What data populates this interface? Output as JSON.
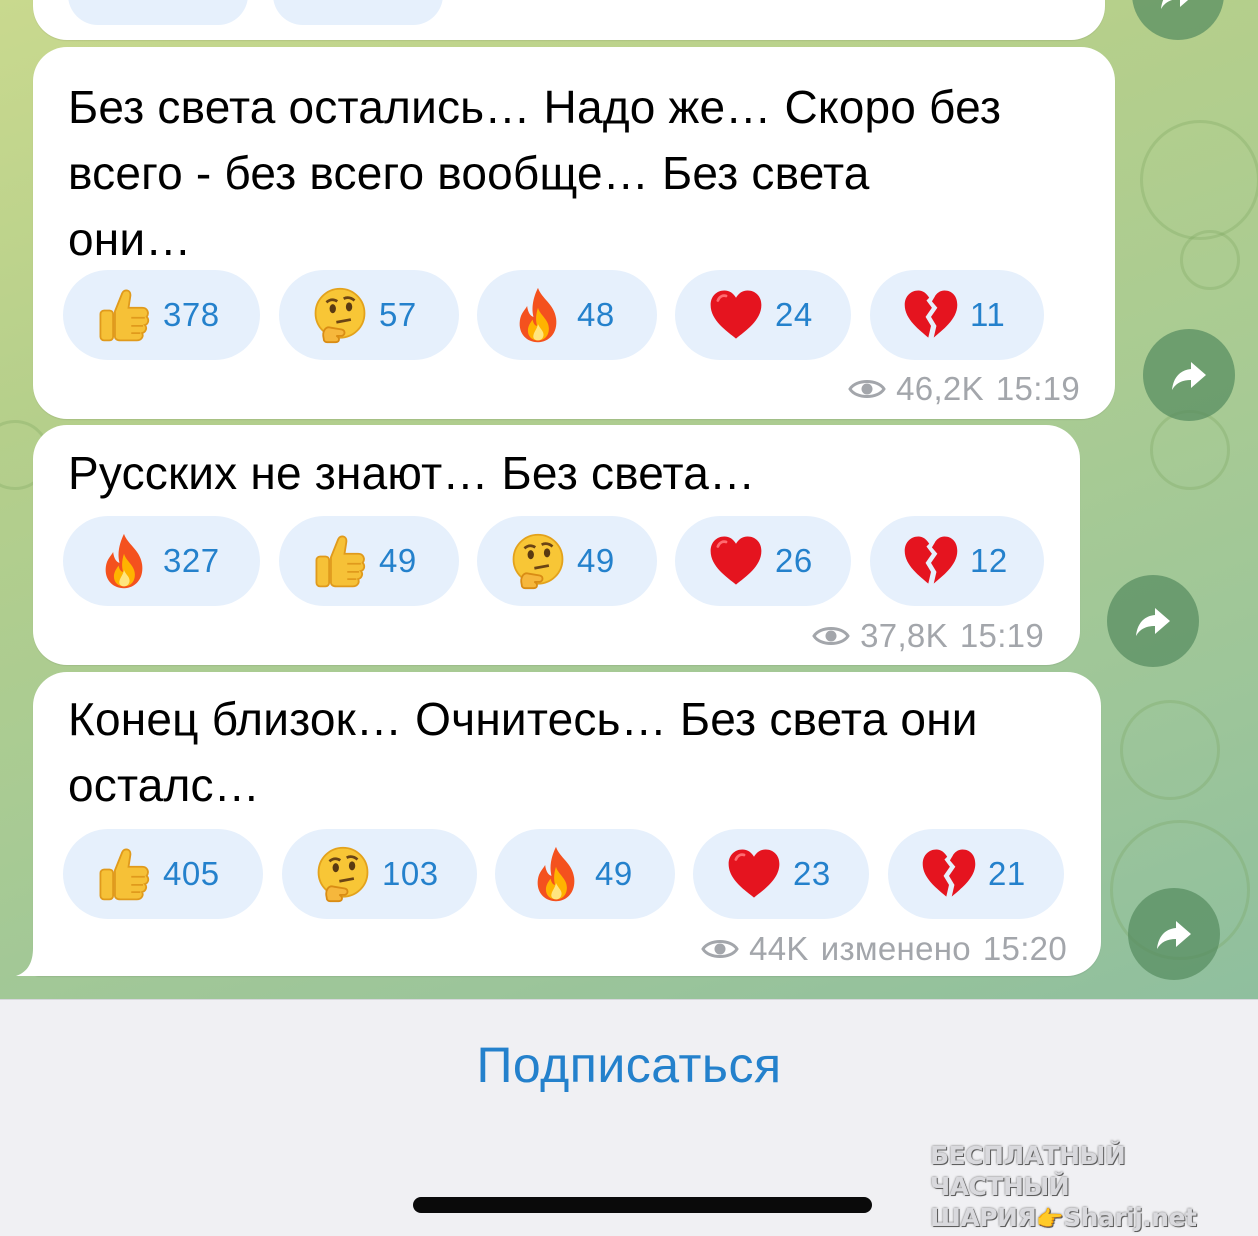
{
  "messages": [
    {
      "text_lines": [
        "Без света остались… Надо же… Скоро без",
        "всего - без всего вообще… Без света",
        "они…"
      ],
      "reactions": [
        {
          "icon": "thumbs-up",
          "count": "378"
        },
        {
          "icon": "thinking-face",
          "count": "57"
        },
        {
          "icon": "fire",
          "count": "48"
        },
        {
          "icon": "red-heart",
          "count": "24"
        },
        {
          "icon": "broken-heart",
          "count": "11"
        }
      ],
      "views": "46,2K",
      "edited_label": "",
      "time": "15:19"
    },
    {
      "text_lines": [
        "Русских не знают… Без света…"
      ],
      "reactions": [
        {
          "icon": "fire",
          "count": "327"
        },
        {
          "icon": "thumbs-up",
          "count": "49"
        },
        {
          "icon": "thinking-face",
          "count": "49"
        },
        {
          "icon": "red-heart",
          "count": "26"
        },
        {
          "icon": "broken-heart",
          "count": "12"
        }
      ],
      "views": "37,8K",
      "edited_label": "",
      "time": "15:19"
    },
    {
      "text_lines": [
        "Конец близок… Очнитесь… Без света они",
        "осталс…"
      ],
      "reactions": [
        {
          "icon": "thumbs-up",
          "count": "405"
        },
        {
          "icon": "thinking-face",
          "count": "103"
        },
        {
          "icon": "fire",
          "count": "49"
        },
        {
          "icon": "red-heart",
          "count": "23"
        },
        {
          "icon": "broken-heart",
          "count": "21"
        }
      ],
      "views": "44K",
      "edited_label": "изменено",
      "time": "15:20"
    }
  ],
  "subscribe_button": "Подписаться",
  "watermark": {
    "line1": "БЕСПЛАТНЫЙ ЧАСТНЫЙ",
    "line2a": "ШАРИЯ",
    "line2b": "Sharij.net"
  },
  "colors": {
    "accent": "#2481cc",
    "reaction_bg": "#e6f0fc",
    "meta_text": "#a3a6ab",
    "bubble": "#ffffff"
  }
}
